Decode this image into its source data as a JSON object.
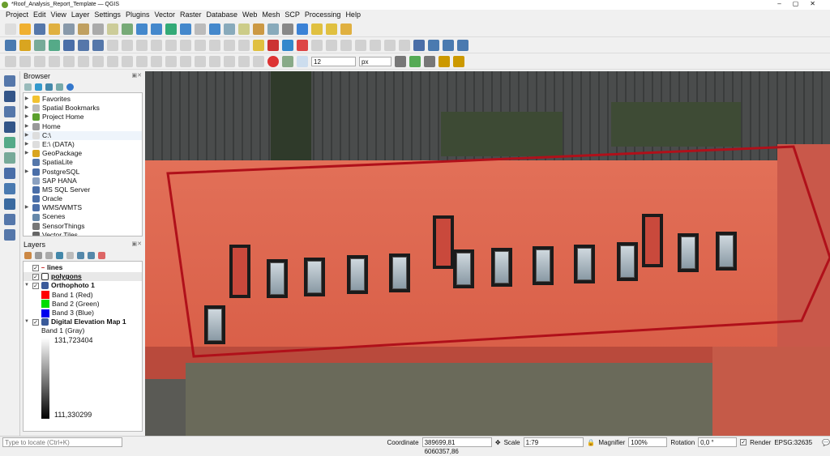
{
  "window": {
    "title": "*Roof_Analysis_Report_Template — QGIS"
  },
  "menu": [
    "Project",
    "Edit",
    "View",
    "Layer",
    "Settings",
    "Plugins",
    "Vector",
    "Raster",
    "Database",
    "Web",
    "Mesh",
    "SCP",
    "Processing",
    "Help"
  ],
  "toolbar": {
    "snap_tolerance": "12",
    "snap_units": "px"
  },
  "browser": {
    "title": "Browser",
    "items": [
      {
        "label": "Favorites",
        "icon": "star-icon",
        "color": "#f2c230",
        "expand": true
      },
      {
        "label": "Spatial Bookmarks",
        "icon": "bookmark-icon",
        "color": "#bbbbbb",
        "expand": true
      },
      {
        "label": "Project Home",
        "icon": "project-home-icon",
        "color": "#5aa02c",
        "expand": true
      },
      {
        "label": "Home",
        "icon": "home-folder-icon",
        "color": "#999999",
        "expand": true
      },
      {
        "label": "C:\\",
        "icon": "folder-icon",
        "color": "#dddddd",
        "expand": true
      },
      {
        "label": "E:\\ (DATA)",
        "icon": "folder-icon",
        "color": "#dddddd",
        "expand": true
      },
      {
        "label": "GeoPackage",
        "icon": "geopackage-icon",
        "color": "#d9a520",
        "expand": true
      },
      {
        "label": "SpatiaLite",
        "icon": "spatialite-icon",
        "color": "#5577aa",
        "expand": false
      },
      {
        "label": "PostgreSQL",
        "icon": "postgresql-icon",
        "color": "#4a6ea8",
        "expand": true
      },
      {
        "label": "SAP HANA",
        "icon": "sap-hana-icon",
        "color": "#8aa0c0",
        "expand": false
      },
      {
        "label": "MS SQL Server",
        "icon": "mssql-icon",
        "color": "#4a6ea8",
        "expand": false
      },
      {
        "label": "Oracle",
        "icon": "oracle-icon",
        "color": "#4a6ea8",
        "expand": false
      },
      {
        "label": "WMS/WMTS",
        "icon": "wms-icon",
        "color": "#4a6ea8",
        "expand": true
      },
      {
        "label": "Scenes",
        "icon": "scenes-icon",
        "color": "#6688aa",
        "expand": false
      },
      {
        "label": "SensorThings",
        "icon": "sensorthings-icon",
        "color": "#777777",
        "expand": false
      },
      {
        "label": "Vector Tiles",
        "icon": "vector-tiles-icon",
        "color": "#666666",
        "expand": false
      }
    ]
  },
  "layers": {
    "title": "Layers",
    "items": [
      {
        "label": "lines",
        "bold": true,
        "checked": true
      },
      {
        "label": "polygons",
        "bold": true,
        "checked": true,
        "underline": true
      },
      {
        "label": "Orthophoto 1",
        "bold": true,
        "checked": true
      }
    ],
    "bands": [
      {
        "label": "Band 1 (Red)",
        "color": "#ff0000"
      },
      {
        "label": "Band 2 (Green)",
        "color": "#00dd00"
      },
      {
        "label": "Band 3 (Blue)",
        "color": "#0000ee"
      }
    ],
    "dem": {
      "label": "Digital Elevation Map 1",
      "band": "Band 1 (Gray)",
      "max": "131,723404",
      "min": "111,330299"
    }
  },
  "status": {
    "locate_placeholder": "Type to locate (Ctrl+K)",
    "coordinate_label": "Coordinate",
    "coordinate": "389699,81  6060357,86",
    "scale_label": "Scale",
    "scale": "1:79",
    "magnifier_label": "Magnifier",
    "magnifier": "100%",
    "rotation_label": "Rotation",
    "rotation": "0,0 °",
    "render_label": "Render",
    "crs": "EPSG:32635"
  }
}
